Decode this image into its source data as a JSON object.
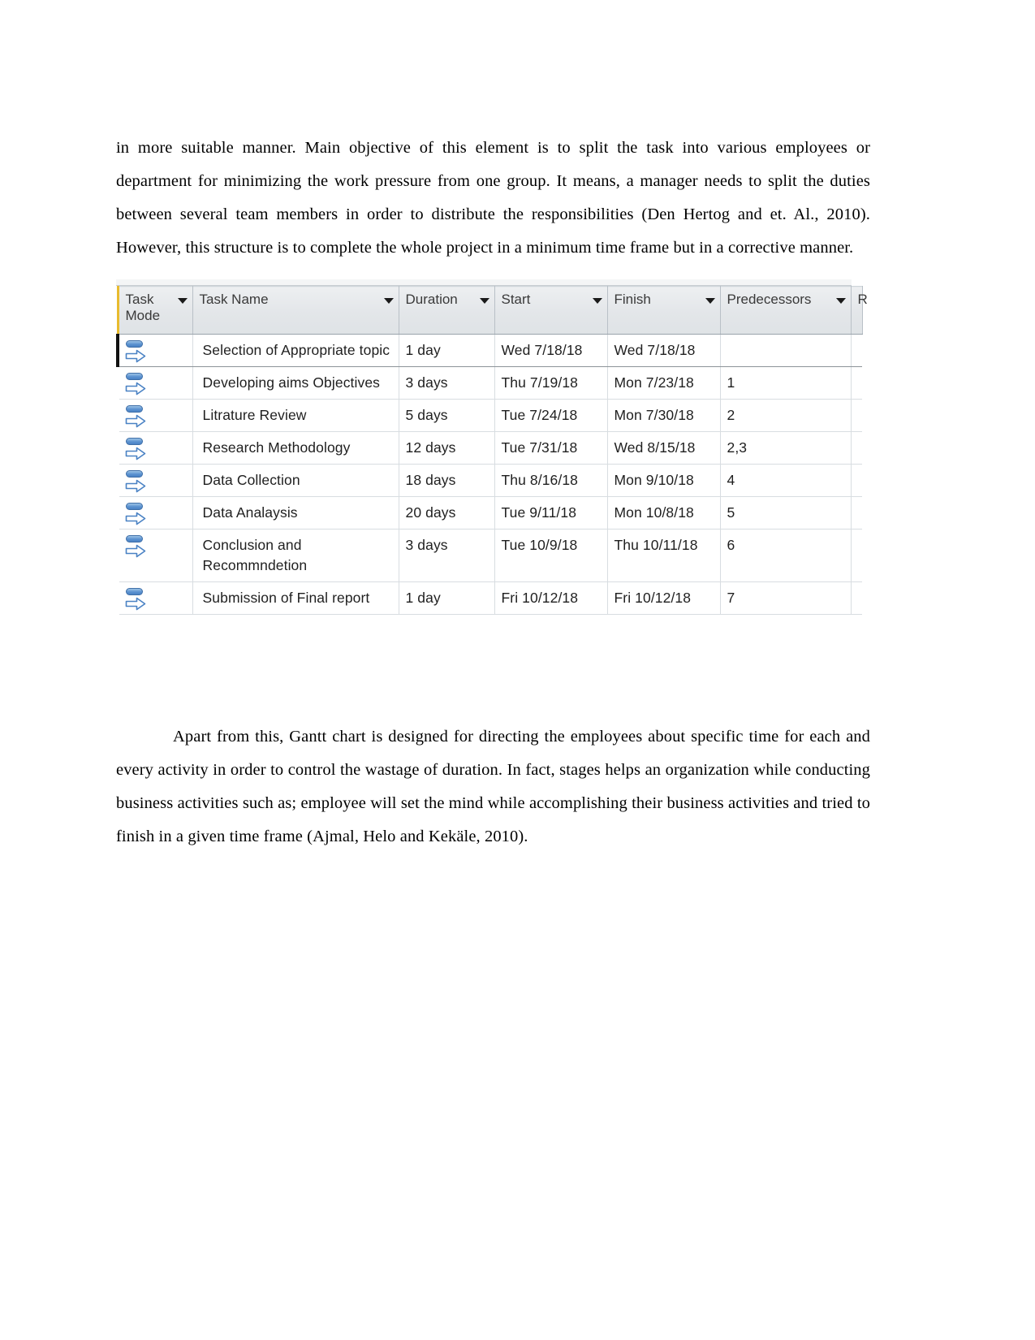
{
  "document": {
    "paragraph_above": "in more suitable manner. Main objective of this element is to split the task into various employees or department for minimizing the work pressure from one group. It means, a manager needs to split the duties between several team members in order to distribute the responsibilities (Den Hertog and et. Al., 2010). However, this structure is to complete the whole project in a minimum time frame but in a corrective manner.",
    "paragraph_below": "Apart from this, Gantt chart is designed for directing the employees about specific time for each and every activity in order to control the wastage of duration. In fact, stages helps an organization while conducting business activities such as; employee will set the mind while accomplishing their business activities and tried to finish in a given time frame (Ajmal, Helo and Kekäle, 2010)."
  },
  "project_table": {
    "columns": [
      {
        "key": "task_mode",
        "label": "Task Mode",
        "has_filter": true
      },
      {
        "key": "task_name",
        "label": "Task Name",
        "has_filter": true
      },
      {
        "key": "duration",
        "label": "Duration",
        "has_filter": true
      },
      {
        "key": "start",
        "label": "Start",
        "has_filter": true
      },
      {
        "key": "finish",
        "label": "Finish",
        "has_filter": true
      },
      {
        "key": "predecessors",
        "label": "Predecessors",
        "has_filter": true
      },
      {
        "key": "partial",
        "label": "R",
        "has_filter": false
      }
    ],
    "rows": [
      {
        "task_mode_icon": "manually-scheduled-icon",
        "task_name": "Selection of Appropriate topic",
        "duration": "1 day",
        "start": "Wed 7/18/18",
        "finish": "Wed 7/18/18",
        "predecessors": "",
        "selected": true
      },
      {
        "task_mode_icon": "manually-scheduled-icon",
        "task_name": "Developing aims Objectives",
        "duration": "3 days",
        "start": "Thu 7/19/18",
        "finish": "Mon 7/23/18",
        "predecessors": "1",
        "selected": false
      },
      {
        "task_mode_icon": "manually-scheduled-icon",
        "task_name": "Litrature Review",
        "duration": "5 days",
        "start": "Tue 7/24/18",
        "finish": "Mon 7/30/18",
        "predecessors": "2",
        "selected": false
      },
      {
        "task_mode_icon": "manually-scheduled-icon",
        "task_name": "Research Methodology",
        "duration": "12 days",
        "start": "Tue 7/31/18",
        "finish": "Wed 8/15/18",
        "predecessors": "2,3",
        "selected": false
      },
      {
        "task_mode_icon": "manually-scheduled-icon",
        "task_name": "Data Collection",
        "duration": "18 days",
        "start": "Thu 8/16/18",
        "finish": "Mon 9/10/18",
        "predecessors": "4",
        "selected": false
      },
      {
        "task_mode_icon": "manually-scheduled-icon",
        "task_name": "Data Analaysis",
        "duration": "20 days",
        "start": "Tue 9/11/18",
        "finish": "Mon 10/8/18",
        "predecessors": "5",
        "selected": false
      },
      {
        "task_mode_icon": "manually-scheduled-icon",
        "task_name": "Conclusion and Recommndetion",
        "duration": "3 days",
        "start": "Tue 10/9/18",
        "finish": "Thu 10/11/18",
        "predecessors": "6",
        "selected": false
      },
      {
        "task_mode_icon": "manually-scheduled-icon",
        "task_name": "Submission of Final report",
        "duration": "1 day",
        "start": "Fri 10/12/18",
        "finish": "Fri 10/12/18",
        "predecessors": "7",
        "selected": false
      }
    ]
  },
  "colors": {
    "header_accent": "#e8bb2e",
    "header_bg": "#e3e6e9",
    "grid_line": "#d8dde1",
    "task_mode_icon_blue": "#5b92d0",
    "selection_bar": "#111111"
  }
}
